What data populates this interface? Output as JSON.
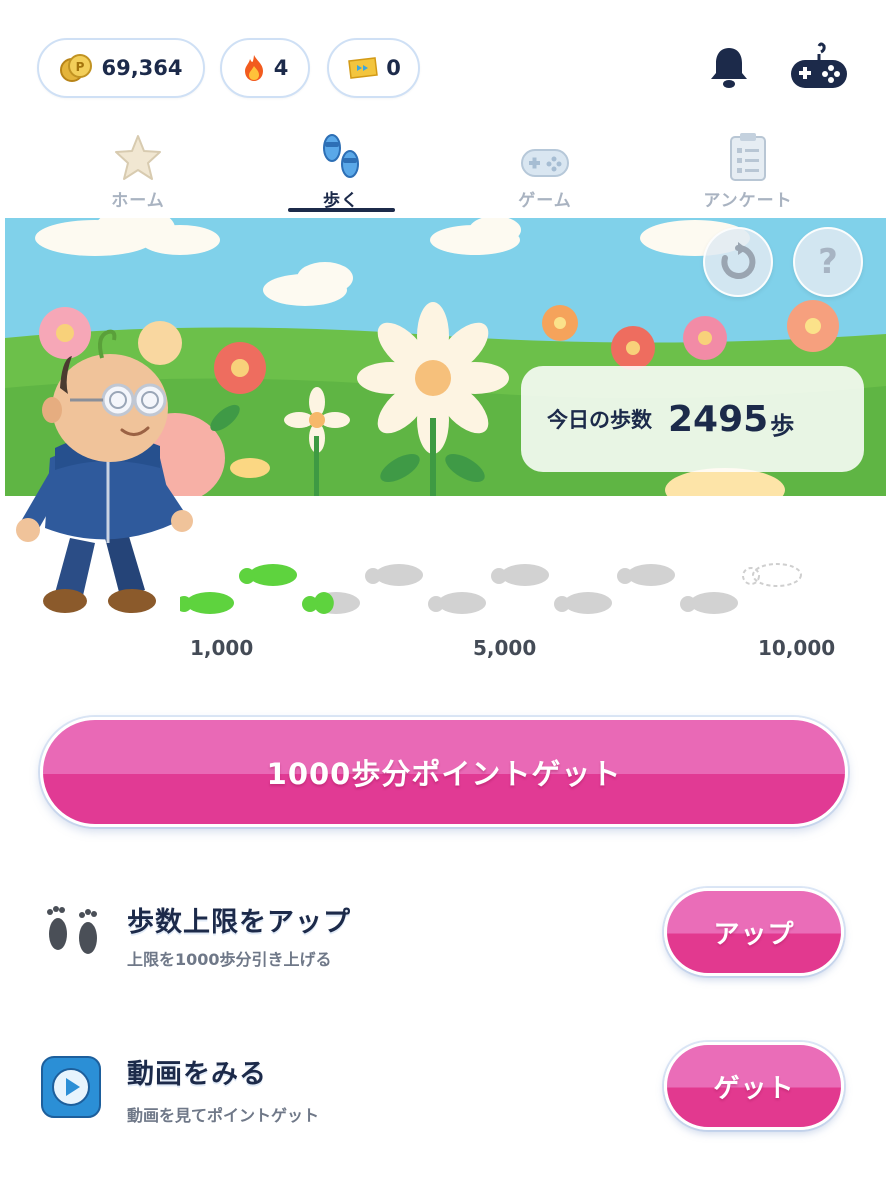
{
  "stats": {
    "coins": "69,364",
    "streak": "4",
    "tickets": "0"
  },
  "tabs": [
    {
      "label": "ホーム",
      "icon": "star-icon",
      "active": false
    },
    {
      "label": "歩く",
      "icon": "slippers-icon",
      "active": true
    },
    {
      "label": "ゲーム",
      "icon": "gamepad-icon",
      "active": false
    },
    {
      "label": "アンケート",
      "icon": "clipboard-icon",
      "active": false
    }
  ],
  "steps_card": {
    "label": "今日の歩数",
    "value": "2495",
    "unit": "歩"
  },
  "progress": {
    "milestones": [
      "1,000",
      "5,000",
      "10,000"
    ],
    "current_steps": 2495,
    "max_steps": 10000
  },
  "cta": {
    "label": "1000歩分ポイントゲット"
  },
  "rows": [
    {
      "title": "歩数上限をアップ",
      "subtitle": "上限を1000歩分引き上げる",
      "button": "アップ",
      "icon": "footprints-icon"
    },
    {
      "title": "動画をみる",
      "subtitle": "動画を見てポイントゲット",
      "button": "ゲット",
      "icon": "play-video-icon"
    }
  ],
  "help_label": "?",
  "colors": {
    "navy": "#1c2a4a",
    "pink_top": "#e969b6",
    "pink_bottom": "#e13a94",
    "step_done": "#5ed33e",
    "step_todo": "#d2d2d2",
    "sky": "#7fd0ea",
    "grass": "#6cc04a"
  }
}
